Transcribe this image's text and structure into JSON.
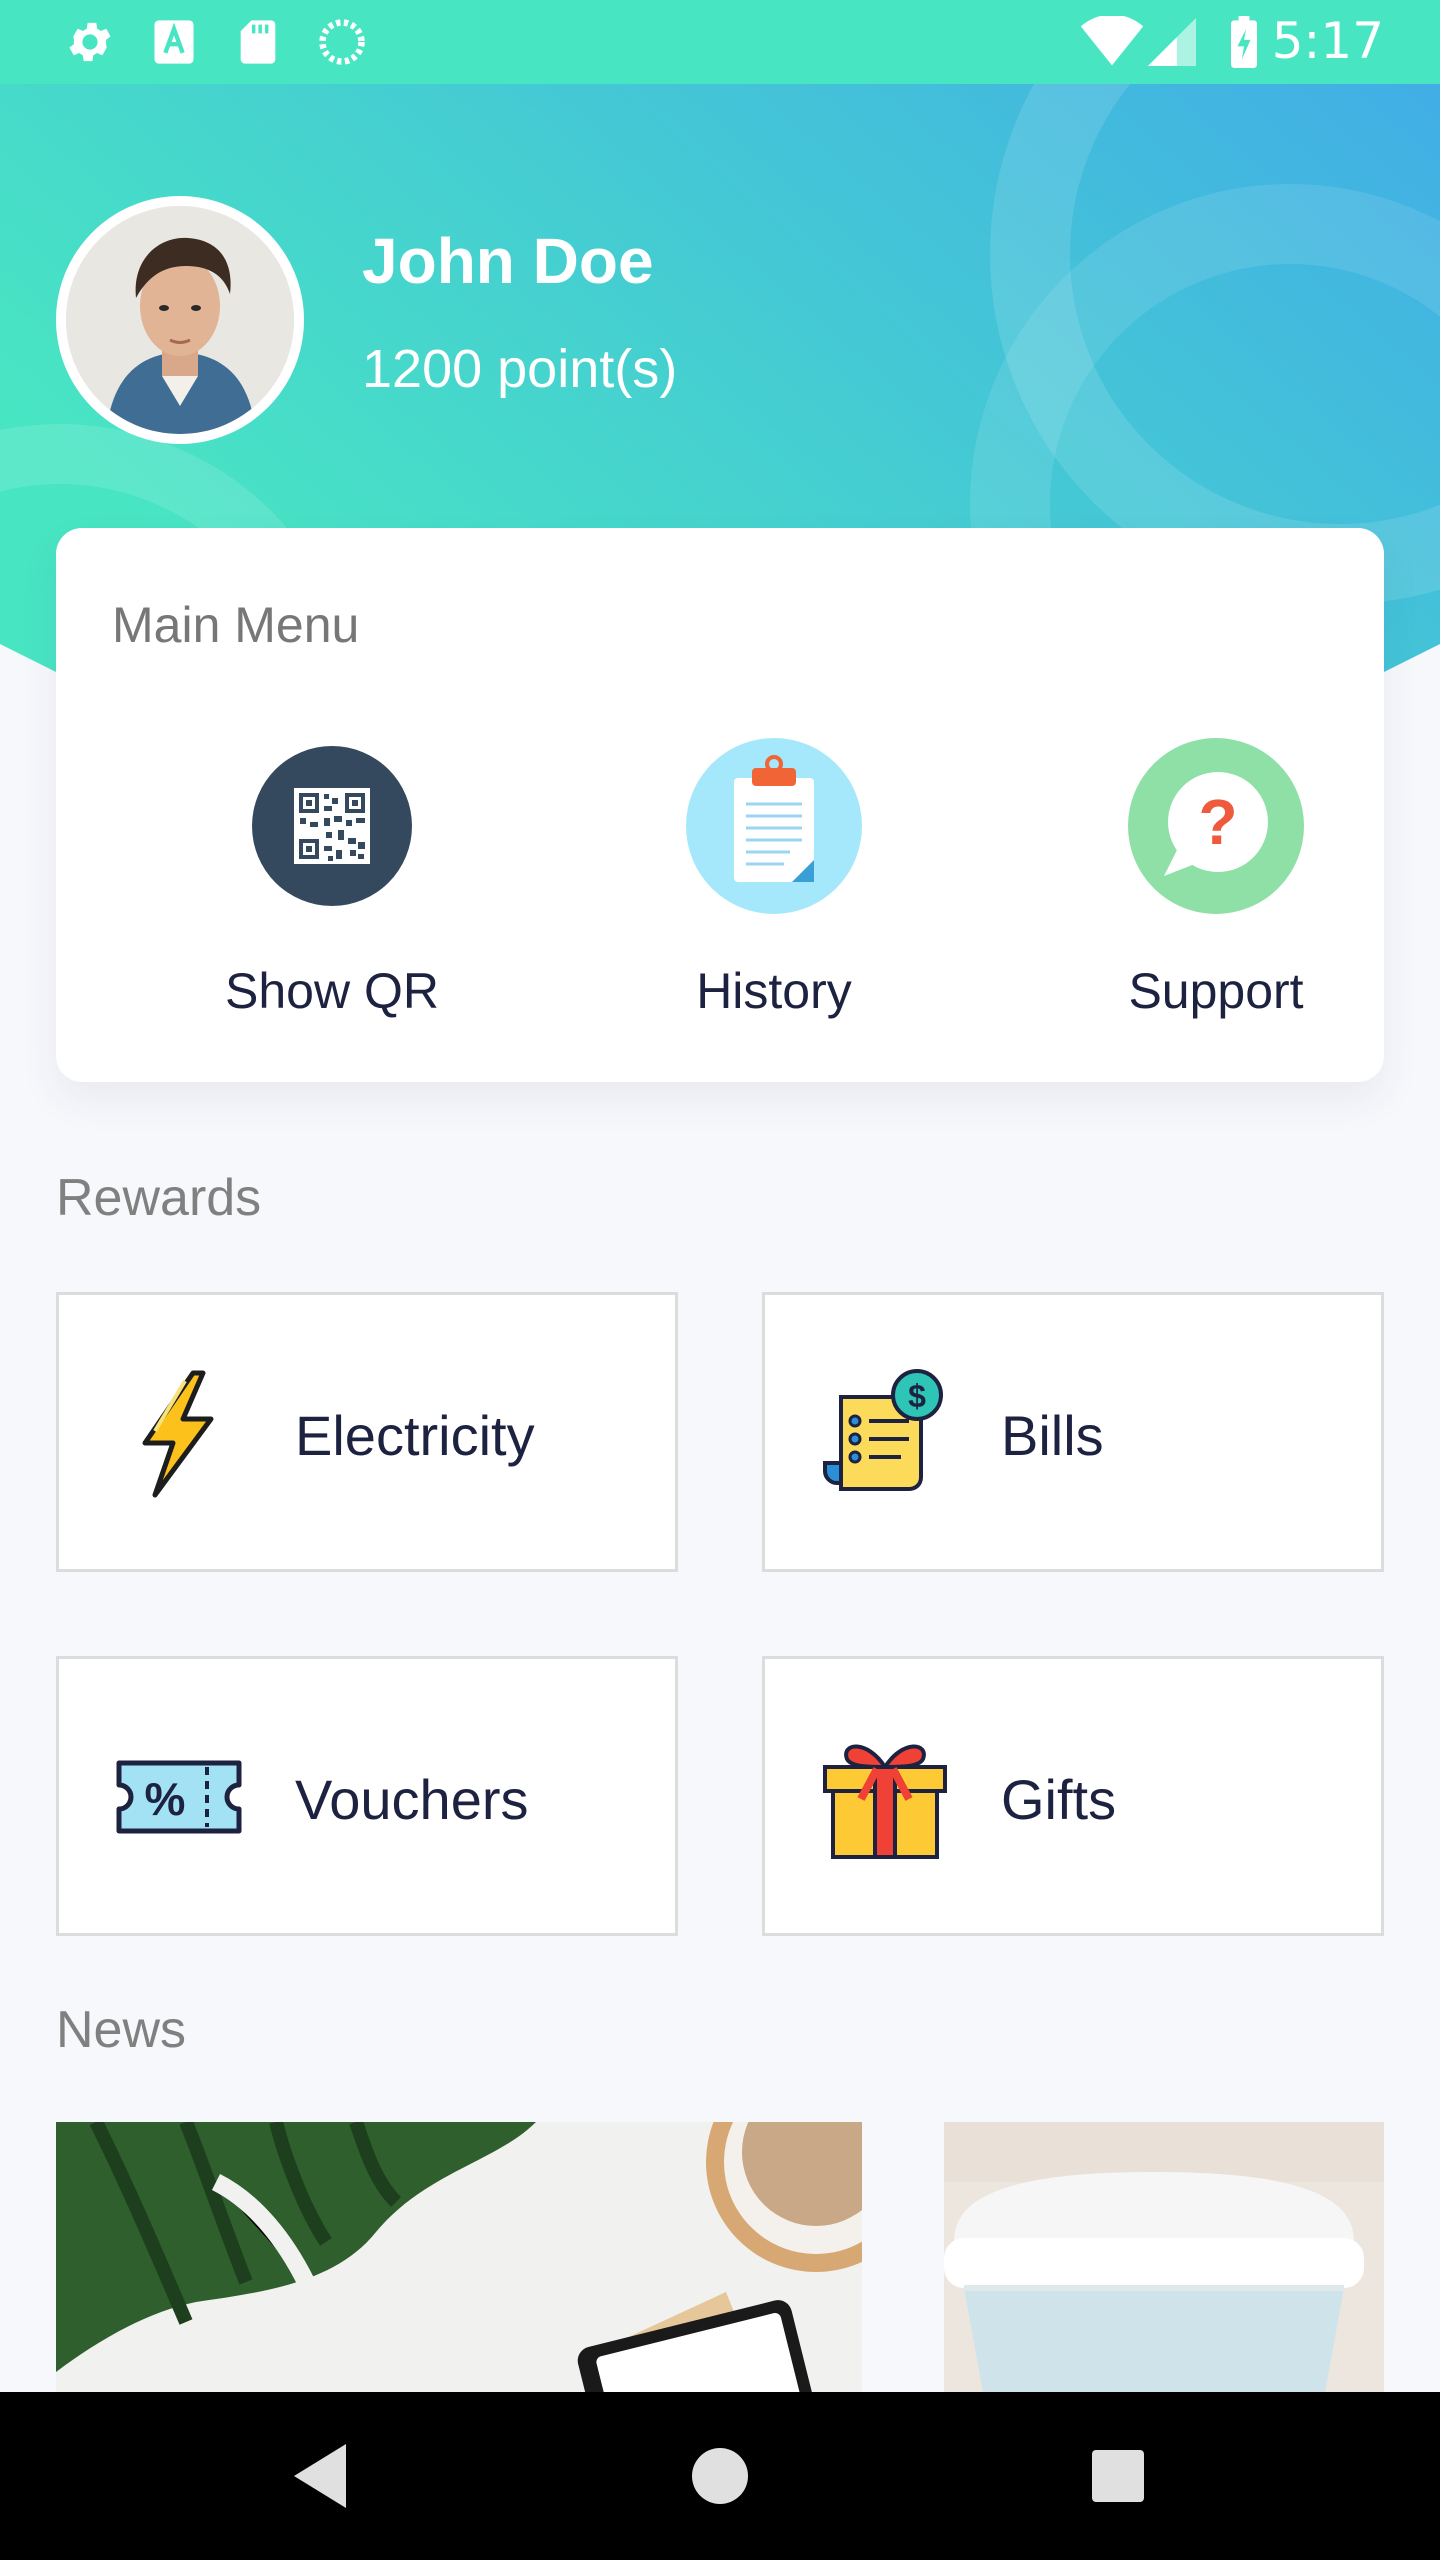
{
  "status_bar": {
    "time": "5:17",
    "left_icons": [
      "gear-icon",
      "font-a-icon",
      "sd-card-icon",
      "sync-icon"
    ],
    "right_icons": [
      "wifi-icon",
      "signal-icon",
      "battery-charging-icon"
    ]
  },
  "profile": {
    "name": "John Doe",
    "points": "1200 point(s)"
  },
  "main_menu": {
    "title": "Main Menu",
    "items": [
      {
        "label": "Show QR",
        "icon": "qr-code-icon",
        "color": "#34495e"
      },
      {
        "label": "History",
        "icon": "clipboard-icon",
        "color": "#a6e8fb"
      },
      {
        "label": "Support",
        "icon": "question-bubble-icon",
        "color": "#8ee0a6"
      }
    ]
  },
  "rewards": {
    "title": "Rewards",
    "items": [
      {
        "label": "Electricity",
        "icon": "lightning-icon"
      },
      {
        "label": "Bills",
        "icon": "bill-receipt-icon"
      },
      {
        "label": "Vouchers",
        "icon": "voucher-ticket-icon"
      },
      {
        "label": "Gifts",
        "icon": "gift-box-icon"
      }
    ]
  },
  "news": {
    "title": "News"
  },
  "nav_bar": {
    "buttons": [
      "back-icon",
      "home-icon",
      "recents-icon"
    ]
  },
  "colors": {
    "status_bar": "#48e5c3",
    "header_gradient_start": "#48e5c3",
    "header_gradient_end": "#41aee5",
    "text_dark": "#1d2240",
    "text_muted": "#808080",
    "background": "#f7f8fc"
  }
}
